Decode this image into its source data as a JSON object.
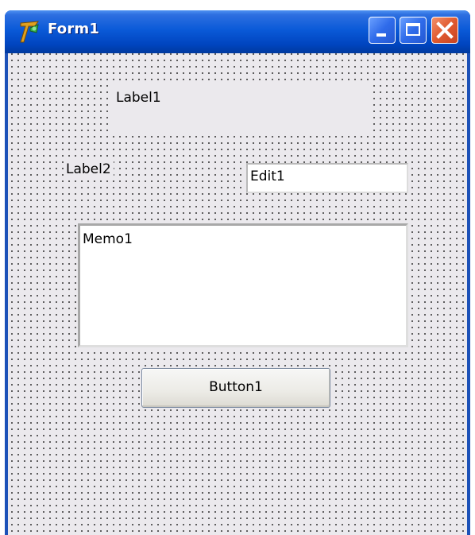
{
  "window": {
    "title": "Form1",
    "app_icon": "delphi-helmet-icon",
    "controls": {
      "minimize_icon": "minimize-icon",
      "maximize_icon": "maximize-icon",
      "close_icon": "close-icon"
    }
  },
  "form": {
    "label1": "Label1",
    "label2": "Label2",
    "edit1": "Edit1",
    "memo1": "Memo1",
    "button1": "Button1"
  },
  "colors": {
    "titlebar": "#0a5ad8",
    "client": "#ebe9ed",
    "close_button": "#e05a2f"
  }
}
